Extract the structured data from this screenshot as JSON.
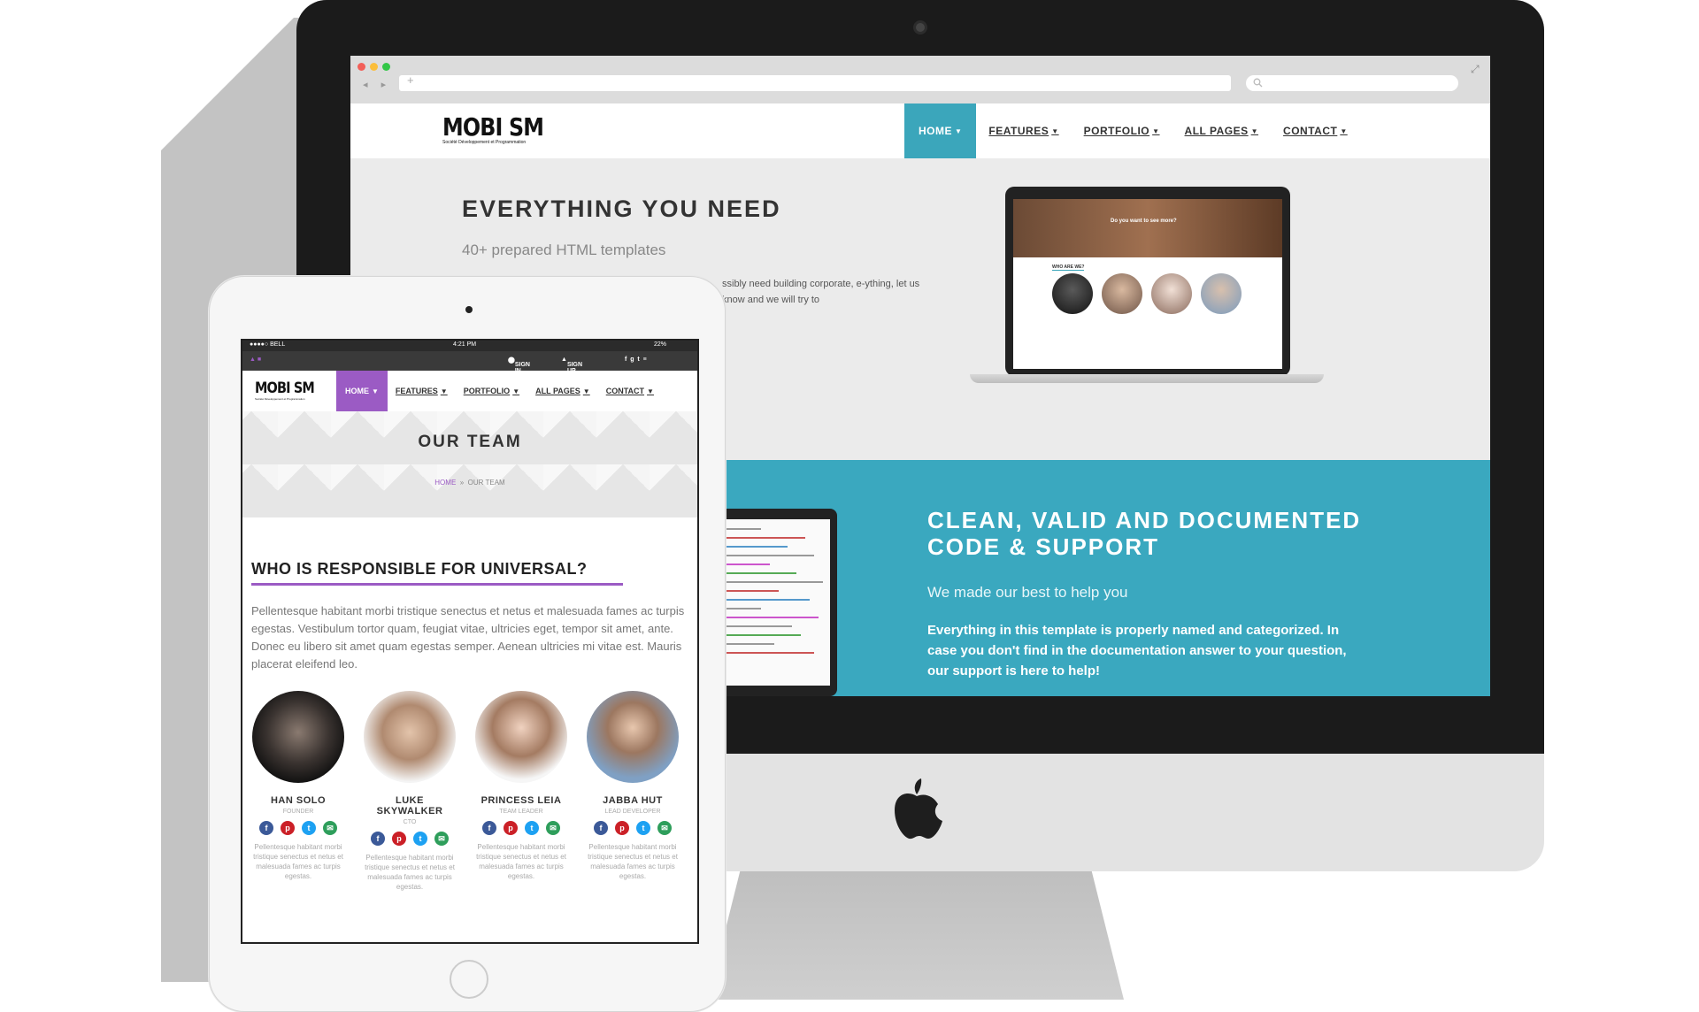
{
  "desktop": {
    "logo": {
      "name": "MOBI SM",
      "tagline": "Société Développement et Programmation"
    },
    "nav": [
      {
        "label": "HOME",
        "active": true
      },
      {
        "label": "FEATURES"
      },
      {
        "label": "PORTFOLIO"
      },
      {
        "label": "ALL PAGES"
      },
      {
        "label": "CONTACT"
      }
    ],
    "hero": {
      "title": "EVERYTHING YOU NEED",
      "subtitle": "40+ prepared HTML templates",
      "text": "ssibly need building corporate, e-ything, let us know and we will try to"
    },
    "laptop_preview": {
      "banner_text": "Do you want to see more?",
      "section_label": "WHO ARE WE?"
    },
    "feature": {
      "title": "CLEAN, VALID AND DOCUMENTED CODE & SUPPORT",
      "subtitle": "We made our best to help you",
      "text": "Everything in this template is properly named and categorized. In case you don't find in the documentation answer to your question, our support is here to help!"
    },
    "colors": {
      "accent": "#3ba6bb",
      "band": "#3aa8bf"
    }
  },
  "tablet": {
    "status": {
      "carrier": "●●●●○ BELL",
      "time": "4:21 PM",
      "battery": "22%"
    },
    "topbar": {
      "sign_in": "SIGN IN",
      "sign_up": "SIGN UP"
    },
    "logo": {
      "name": "MOBI SM"
    },
    "nav": [
      {
        "label": "HOME",
        "active": true
      },
      {
        "label": "FEATURES"
      },
      {
        "label": "PORTFOLIO"
      },
      {
        "label": "ALL PAGES"
      },
      {
        "label": "CONTACT"
      }
    ],
    "banner": {
      "title": "OUR TEAM",
      "crumb_home": "HOME",
      "crumb_sep": "»",
      "crumb_current": "OUR TEAM"
    },
    "section_title": "WHO IS RESPONSIBLE FOR UNIVERSAL?",
    "intro": "Pellentesque habitant morbi tristique senectus et netus et malesuada fames ac turpis egestas. Vestibulum tortor quam, feugiat vitae, ultricies eget, tempor sit amet, ante. Donec eu libero sit amet quam egestas semper. Aenean ultricies mi vitae est. Mauris placerat eleifend leo.",
    "team": [
      {
        "name": "HAN SOLO",
        "role": "FOUNDER",
        "blurb": "Pellentesque habitant morbi tristique senectus et netus et malesuada fames ac turpis egestas."
      },
      {
        "name": "LUKE SKYWALKER",
        "role": "CTO",
        "blurb": "Pellentesque habitant morbi tristique senectus et netus et malesuada fames ac turpis egestas."
      },
      {
        "name": "PRINCESS LEIA",
        "role": "TEAM LEADER",
        "blurb": "Pellentesque habitant morbi tristique senectus et netus et malesuada fames ac turpis egestas."
      },
      {
        "name": "JABBA HUT",
        "role": "LEAD DEVELOPER",
        "blurb": "Pellentesque habitant morbi tristique senectus et netus et malesuada fames ac turpis egestas."
      }
    ],
    "social_icons": [
      {
        "name": "facebook-icon",
        "glyph": "f",
        "color": "#3b5998"
      },
      {
        "name": "pinterest-icon",
        "glyph": "p",
        "color": "#cb2027"
      },
      {
        "name": "twitter-icon",
        "glyph": "t",
        "color": "#1da1f2"
      },
      {
        "name": "email-icon",
        "glyph": "✉",
        "color": "#2e9e5b"
      }
    ],
    "colors": {
      "accent": "#9b5bc4"
    }
  }
}
